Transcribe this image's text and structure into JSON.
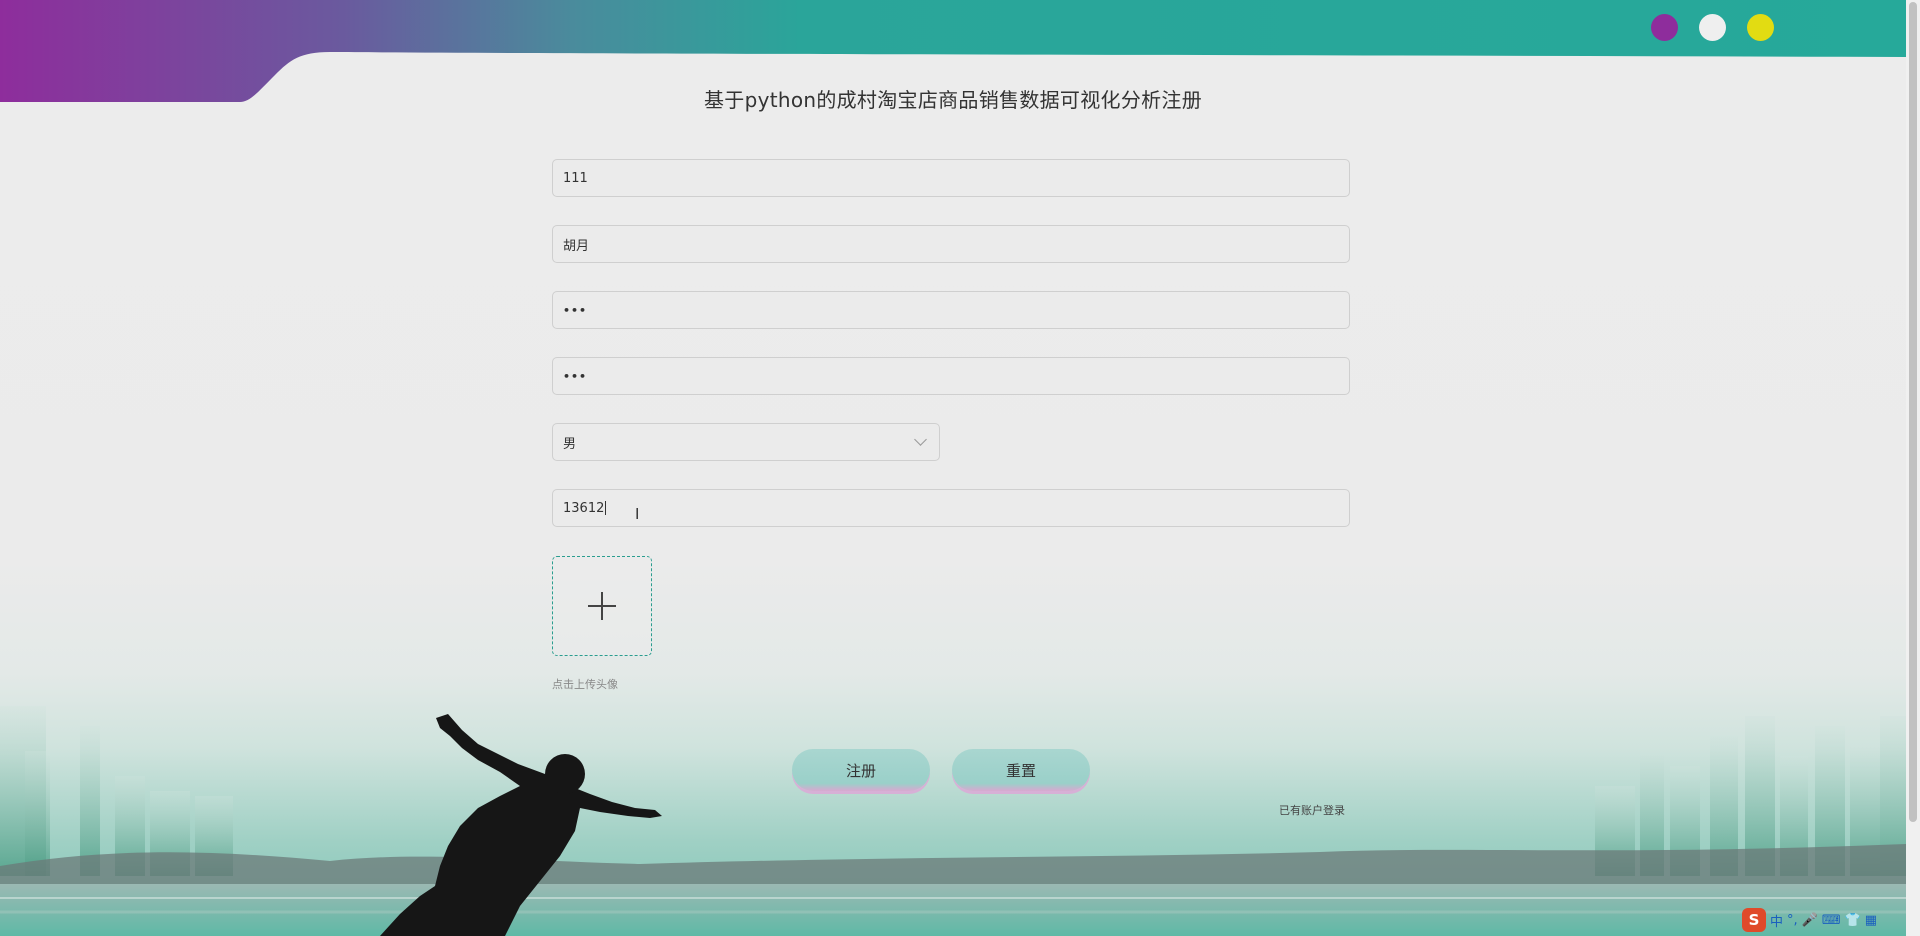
{
  "page": {
    "title": "基于python的成村淘宝店商品销售数据可视化分析注册"
  },
  "header": {
    "dots": [
      {
        "name": "purple",
        "color": "#8e2d9c"
      },
      {
        "name": "white",
        "color": "#efefef"
      },
      {
        "name": "yellow",
        "color": "#e2dc12"
      }
    ]
  },
  "form": {
    "username": {
      "value": "111"
    },
    "name": {
      "value": "胡月"
    },
    "password": {
      "value": "•••"
    },
    "confirm_password": {
      "value": "•••"
    },
    "gender": {
      "selected": "男"
    },
    "phone": {
      "value": "13612"
    },
    "avatar": {
      "tip": "点击上传头像"
    }
  },
  "actions": {
    "register_label": "注册",
    "reset_label": "重置",
    "login_link": "已有账户登录"
  },
  "ime": {
    "logo": "S",
    "items": [
      "中",
      "°,",
      "🎤",
      "⌨",
      "👕",
      "▦"
    ]
  },
  "colors": {
    "accent": "#2a9d8f",
    "header_gradient_start": "#8e2d9c",
    "header_gradient_end": "#26a99a"
  }
}
